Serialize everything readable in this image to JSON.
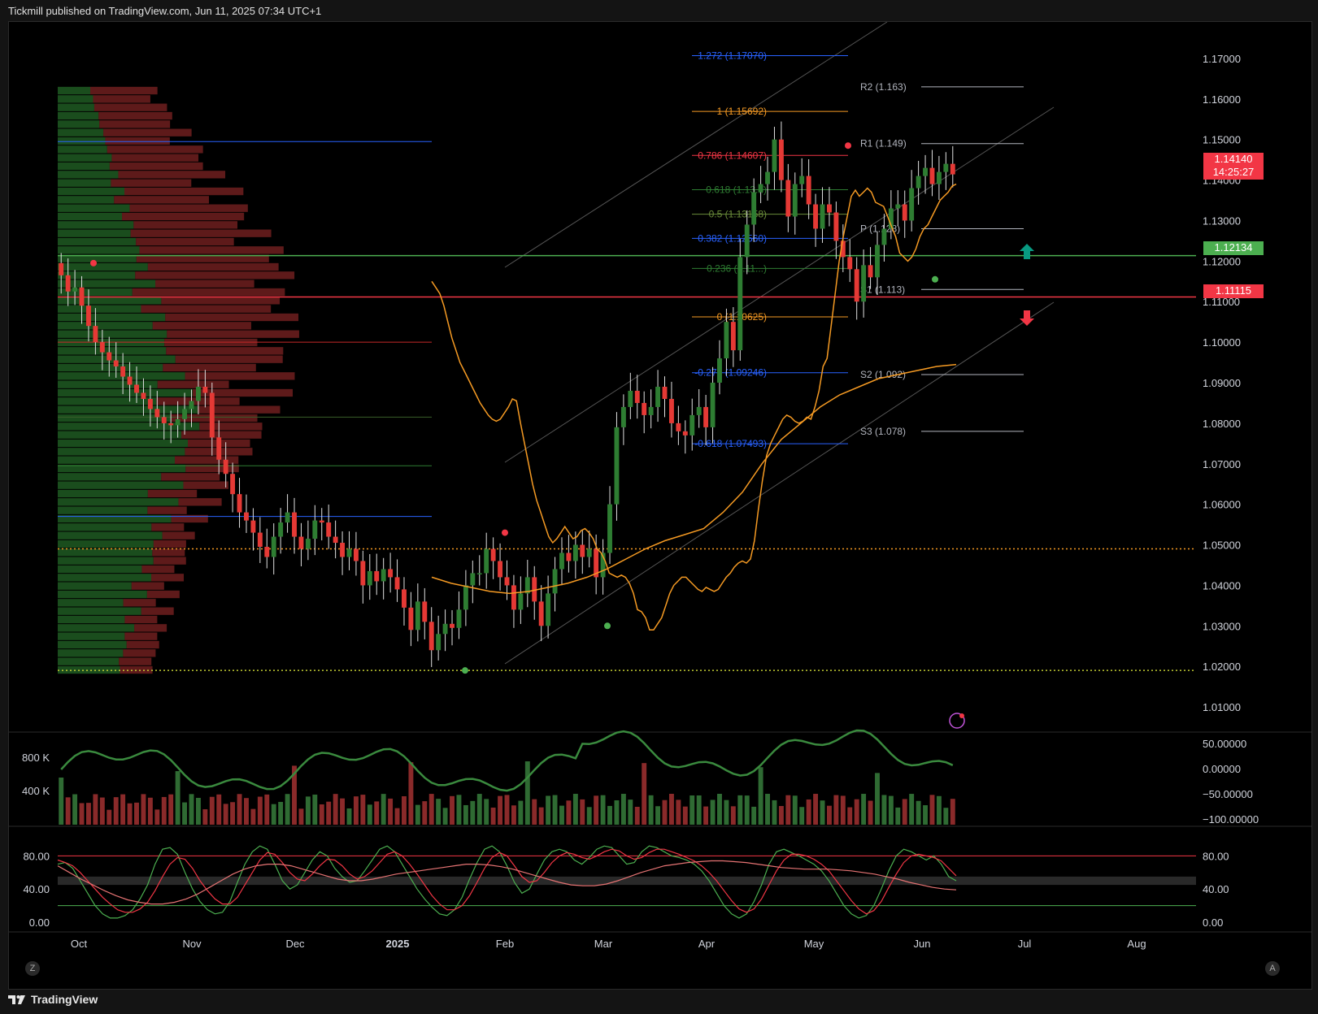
{
  "header": "Tickmill published on TradingView.com, Jun 11, 2025 07:34 UTC+1",
  "footer": {
    "brand": "TradingView",
    "logo_icon": "tradingview-logo-icon"
  },
  "buttons": {
    "left": "Z",
    "right": "A"
  },
  "colors": {
    "up": "#2e7d32",
    "down": "#e53935",
    "ema": "#f59a23",
    "support": "#4caf50",
    "resistance": "#f23645",
    "pivot": "#b2b5be"
  },
  "price_badges": [
    {
      "value": "1.14140",
      "sub": "14:25:27",
      "color": "#f23645"
    },
    {
      "value": "1.12134",
      "sub": "",
      "color": "#4caf50"
    },
    {
      "value": "1.11115",
      "sub": "",
      "color": "#f23645"
    }
  ],
  "chart_data": {
    "type": "candlestick",
    "y_axis": [
      "1.17000",
      "1.16000",
      "1.15000",
      "1.14000",
      "1.13000",
      "1.12000",
      "1.11000",
      "1.10000",
      "1.09000",
      "1.08000",
      "1.07000",
      "1.06000",
      "1.05000",
      "1.04000",
      "1.03000",
      "1.02000",
      "1.01000"
    ],
    "ylim": [
      1.005,
      1.175
    ],
    "x_axis": [
      "Oct",
      "Nov",
      "Dec",
      "2025",
      "Feb",
      "Mar",
      "Apr",
      "May",
      "Jun",
      "Jul",
      "Aug"
    ],
    "closes": [
      1.1165,
      1.1125,
      1.1135,
      1.109,
      1.104,
      1.1,
      1.0975,
      1.0955,
      1.094,
      1.0915,
      1.0895,
      1.0875,
      1.086,
      1.0835,
      1.0815,
      1.08,
      1.0795,
      1.081,
      1.0835,
      1.0855,
      1.089,
      1.0875,
      1.0765,
      1.071,
      1.0675,
      1.0625,
      1.058,
      1.056,
      1.053,
      1.0495,
      1.047,
      1.052,
      1.0555,
      1.058,
      1.052,
      1.049,
      1.0515,
      1.056,
      1.0555,
      1.052,
      1.0505,
      1.047,
      1.049,
      1.046,
      1.04,
      1.0435,
      1.041,
      1.044,
      1.042,
      1.039,
      1.0345,
      1.029,
      1.036,
      1.031,
      1.024,
      1.028,
      1.0305,
      1.0295,
      1.034,
      1.04,
      1.043,
      1.043,
      1.049,
      1.046,
      1.042,
      1.04,
      1.034,
      1.038,
      1.042,
      1.036,
      1.03,
      1.038,
      1.044,
      1.048,
      1.046,
      1.05,
      1.047,
      1.049,
      1.042,
      1.048,
      1.06,
      1.079,
      1.084,
      1.088,
      1.085,
      1.082,
      1.084,
      1.089,
      1.086,
      1.08,
      1.078,
      1.077,
      1.082,
      1.084,
      1.079,
      1.09,
      1.096,
      1.105,
      1.098,
      1.121,
      1.129,
      1.137,
      1.139,
      1.142,
      1.15,
      1.14,
      1.131,
      1.139,
      1.141,
      1.134,
      1.128,
      1.134,
      1.132,
      1.125,
      1.121,
      1.118,
      1.11,
      1.119,
      1.116,
      1.124,
      1.128,
      1.133,
      1.134,
      1.13,
      1.138,
      1.141,
      1.143,
      1.139,
      1.142,
      1.144,
      1.1414
    ],
    "ema_fast": [
      1.115,
      1.1135,
      1.112,
      1.109,
      1.105,
      1.101,
      1.098,
      1.095,
      1.093,
      1.091,
      1.089,
      1.087,
      1.085,
      1.0835,
      1.082,
      1.081,
      1.0805,
      1.081,
      1.0825,
      1.084,
      1.086,
      1.0855,
      1.08,
      1.075,
      1.07,
      1.065,
      1.061,
      1.058,
      1.055,
      1.052,
      1.0505,
      1.0515,
      1.053,
      1.0545,
      1.053,
      1.0515,
      1.052,
      1.0535,
      1.054,
      1.053,
      1.0515,
      1.049,
      1.048,
      1.046,
      1.043,
      1.0425,
      1.042,
      1.0425,
      1.042,
      1.0405,
      1.038,
      1.034,
      1.0335,
      1.032,
      1.029,
      1.029,
      1.0305,
      1.032,
      1.035,
      1.038,
      1.04,
      1.041,
      1.042,
      1.042,
      1.041,
      1.04,
      1.039,
      1.0385,
      1.0395,
      1.039,
      1.0385,
      1.039,
      1.0405,
      1.042,
      1.043,
      1.0445,
      1.0455,
      1.046,
      1.0455,
      1.0465,
      1.051,
      1.059,
      1.066,
      1.072,
      1.075,
      1.077,
      1.079,
      1.081,
      1.082,
      1.0815,
      1.0805,
      1.08,
      1.0805,
      1.0815,
      1.081,
      1.084,
      1.088,
      1.094,
      1.096,
      1.104,
      1.112,
      1.12,
      1.126,
      1.131,
      1.136,
      1.1375,
      1.136,
      1.137,
      1.138,
      1.137,
      1.1345,
      1.134,
      1.1335,
      1.131,
      1.1285,
      1.126,
      1.122,
      1.121,
      1.12,
      1.121,
      1.123,
      1.126,
      1.128,
      1.129,
      1.131,
      1.133,
      1.135,
      1.136,
      1.137,
      1.1385,
      1.139
    ],
    "ema_slow": [
      1.042,
      1.0405,
      1.0395,
      1.0385,
      1.038,
      1.0385,
      1.0395,
      1.0405,
      1.042,
      1.044,
      1.0465,
      1.049,
      1.051,
      1.0525,
      1.054,
      1.058,
      1.063,
      1.07,
      1.076,
      1.08,
      1.084,
      1.087,
      1.089,
      1.091,
      1.092,
      1.093,
      1.094,
      1.0945
    ],
    "fibonacci": [
      {
        "label": "1.272 (1.17070)",
        "value": 1.1707,
        "color": "#2962ff"
      },
      {
        "label": "1 (1.15692)",
        "value": 1.15692,
        "color": "#f59a23"
      },
      {
        "label": "0.786 (1.14607)",
        "value": 1.14607,
        "color": "#f23645"
      },
      {
        "label": "0.618 (1.13...)",
        "value": 1.1376,
        "color": "#2e7d32"
      },
      {
        "label": "0.5 (1.13158)",
        "value": 1.13158,
        "color": "#6a8c3a"
      },
      {
        "label": "0.382 (1.12560)",
        "value": 1.1256,
        "color": "#2962ff"
      },
      {
        "label": "0.236 (1.11...)",
        "value": 1.1182,
        "color": "#2e7d32"
      },
      {
        "label": "0 (1.10625)",
        "value": 1.10625,
        "color": "#f59a23"
      },
      {
        "label": "-0.272 (1.09246)",
        "value": 1.09246,
        "color": "#2962ff"
      },
      {
        "label": "-0.618 (1.07493)",
        "value": 1.07493,
        "color": "#2962ff"
      }
    ],
    "pivots": [
      {
        "label": "R2 (1.163)",
        "value": 1.163
      },
      {
        "label": "R1 (1.149)",
        "value": 1.149
      },
      {
        "label": "P (1.128)",
        "value": 1.128
      },
      {
        "label": "S1 (1.113)",
        "value": 1.113
      },
      {
        "label": "S2 (1.092)",
        "value": 1.092
      },
      {
        "label": "S3 (1.078)",
        "value": 1.078
      }
    ],
    "horizontal_levels": [
      {
        "value": 1.12134,
        "color": "#4caf50"
      },
      {
        "value": 1.11115,
        "color": "#f23645"
      },
      {
        "value": 1.049,
        "color": "#f59a23",
        "dashed": true
      },
      {
        "value": 1.019,
        "color": "#c0ca33",
        "dashed": true
      }
    ],
    "volume_axis": [
      "800 K",
      "400 K"
    ],
    "cmf_axis": [
      "50.00000",
      "0.00000",
      "−50.00000",
      "−100.00000"
    ],
    "stoch_axis_left": [
      "80.00",
      "40.00",
      "0.00"
    ],
    "stoch_axis_right": [
      "80.00",
      "40.00",
      "0.00"
    ],
    "stoch_k": [
      70,
      72,
      65,
      50,
      35,
      20,
      10,
      5,
      5,
      8,
      15,
      28,
      45,
      70,
      88,
      90,
      82,
      60,
      40,
      25,
      15,
      10,
      12,
      25,
      48,
      70,
      85,
      92,
      88,
      70,
      50,
      40,
      45,
      60,
      75,
      85,
      80,
      65,
      55,
      48,
      50,
      62,
      75,
      88,
      92,
      85,
      70,
      55,
      40,
      28,
      18,
      10,
      8,
      15,
      30,
      52,
      72,
      88,
      92,
      85,
      68,
      48,
      35,
      40,
      58,
      75,
      85,
      88,
      85,
      75,
      70,
      78,
      88,
      92,
      90,
      80,
      70,
      72,
      85,
      92,
      90,
      85,
      80,
      78,
      75,
      70,
      62,
      50,
      35,
      20,
      10,
      5,
      10,
      25,
      45,
      70,
      85,
      88,
      84,
      80,
      75,
      70,
      62,
      50,
      35,
      20,
      10,
      5,
      8,
      20,
      40,
      62,
      80,
      88,
      85,
      80,
      75,
      80,
      70,
      55,
      50
    ],
    "stoch_d": [
      75,
      72,
      68,
      60,
      50,
      40,
      30,
      22,
      15,
      12,
      12,
      16,
      24,
      38,
      55,
      70,
      78,
      76,
      65,
      50,
      38,
      28,
      22,
      22,
      30,
      45,
      60,
      75,
      84,
      82,
      72,
      60,
      52,
      50,
      58,
      68,
      76,
      75,
      68,
      58,
      52,
      55,
      62,
      72,
      82,
      85,
      80,
      70,
      58,
      45,
      32,
      22,
      15,
      15,
      20,
      32,
      48,
      65,
      78,
      84,
      80,
      68,
      55,
      48,
      50,
      60,
      72,
      80,
      84,
      82,
      78,
      76,
      80,
      85,
      88,
      86,
      80,
      76,
      78,
      84,
      88,
      88,
      85,
      82,
      78,
      74,
      68,
      60,
      50,
      38,
      26,
      16,
      12,
      16,
      28,
      45,
      62,
      75,
      82,
      82,
      80,
      76,
      70,
      62,
      50,
      38,
      26,
      16,
      10,
      14,
      25,
      42,
      58,
      72,
      80,
      82,
      80,
      78,
      74,
      65,
      56
    ],
    "stoch_slow": [
      68,
      60,
      52,
      45,
      38,
      32,
      27,
      24,
      22,
      22,
      24,
      28,
      34,
      42,
      50,
      58,
      64,
      68,
      70,
      70,
      68,
      64,
      60,
      56,
      52,
      50,
      50,
      52,
      55,
      58,
      60,
      62,
      64,
      66,
      68,
      70,
      70,
      69,
      67,
      64,
      60,
      56,
      52,
      48,
      45,
      44,
      44,
      46,
      50,
      55,
      60,
      64,
      68,
      70,
      72,
      73,
      74,
      74,
      73,
      72,
      70,
      68,
      66,
      65,
      64,
      64,
      64,
      63,
      62,
      60,
      58,
      55,
      52,
      48,
      45,
      42,
      40,
      39
    ],
    "markers": [
      {
        "type": "sell",
        "color": "#f23645"
      },
      {
        "type": "buy",
        "color": "#089981"
      }
    ]
  }
}
